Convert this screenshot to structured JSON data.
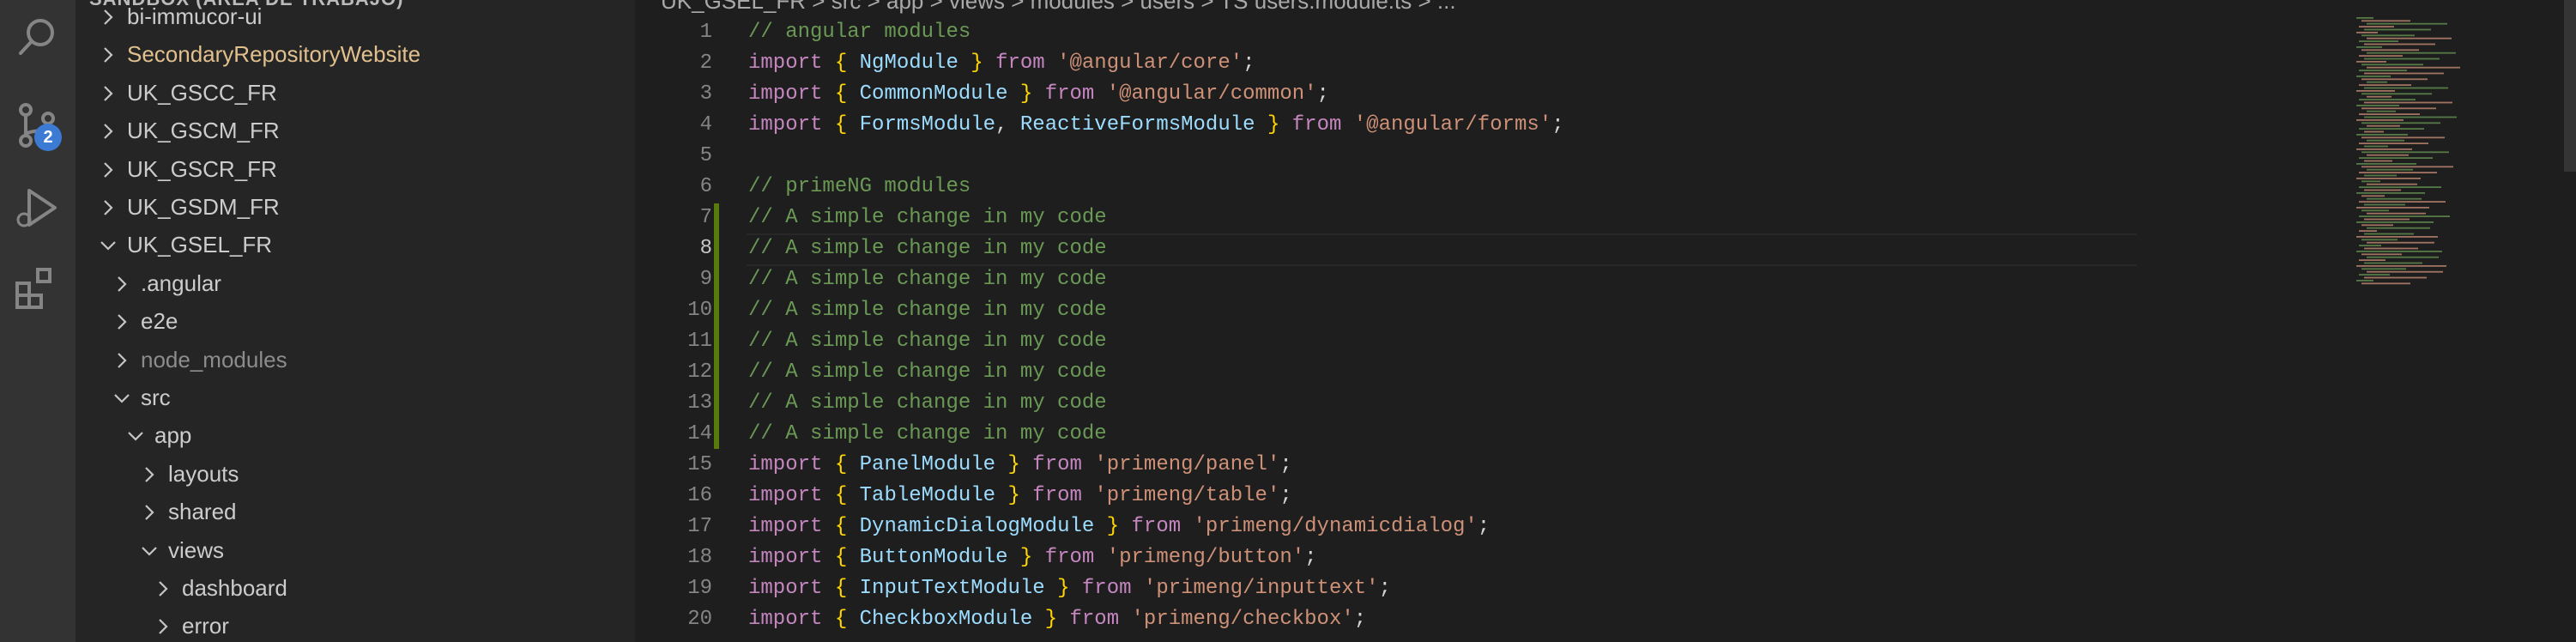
{
  "activity_bar": {
    "scm_badge": "2",
    "icons": [
      "search-icon",
      "source-control-icon",
      "run-debug-icon",
      "extensions-icon"
    ]
  },
  "sidebar": {
    "header": "SANDBOX (ÁREA DE TRABAJO)",
    "items": [
      {
        "label": "bi-immucor-ui",
        "indent": 0,
        "chevron": "right",
        "style": "normal"
      },
      {
        "label": "SecondaryRepositoryWebsite",
        "indent": 0,
        "chevron": "right",
        "style": "modified"
      },
      {
        "label": "UK_GSCC_FR",
        "indent": 0,
        "chevron": "right",
        "style": "normal"
      },
      {
        "label": "UK_GSCM_FR",
        "indent": 0,
        "chevron": "right",
        "style": "normal"
      },
      {
        "label": "UK_GSCR_FR",
        "indent": 0,
        "chevron": "right",
        "style": "normal"
      },
      {
        "label": "UK_GSDM_FR",
        "indent": 0,
        "chevron": "right",
        "style": "normal"
      },
      {
        "label": "UK_GSEL_FR",
        "indent": 0,
        "chevron": "down",
        "style": "normal"
      },
      {
        "label": ".angular",
        "indent": 1,
        "chevron": "right",
        "style": "normal"
      },
      {
        "label": "e2e",
        "indent": 1,
        "chevron": "right",
        "style": "normal"
      },
      {
        "label": "node_modules",
        "indent": 1,
        "chevron": "right",
        "style": "dim"
      },
      {
        "label": "src",
        "indent": 1,
        "chevron": "down",
        "style": "normal"
      },
      {
        "label": "app",
        "indent": 2,
        "chevron": "down",
        "style": "normal"
      },
      {
        "label": "layouts",
        "indent": 3,
        "chevron": "right",
        "style": "normal"
      },
      {
        "label": "shared",
        "indent": 3,
        "chevron": "right",
        "style": "normal"
      },
      {
        "label": "views",
        "indent": 3,
        "chevron": "down",
        "style": "normal"
      },
      {
        "label": "dashboard",
        "indent": 4,
        "chevron": "right",
        "style": "normal"
      },
      {
        "label": "error",
        "indent": 4,
        "chevron": "right",
        "style": "normal"
      }
    ]
  },
  "editor": {
    "breadcrumb": "UK_GSEL_FR > src > app > views > modules > users > TS users.module.ts > ...",
    "active_line": 8,
    "lines": [
      {
        "n": "1",
        "tokens": [
          [
            "c",
            "// angular modules"
          ]
        ]
      },
      {
        "n": "2",
        "tokens": [
          [
            "k",
            "import"
          ],
          [
            "p",
            " "
          ],
          [
            "b",
            "{"
          ],
          [
            "p",
            " "
          ],
          [
            "i",
            "NgModule"
          ],
          [
            "p",
            " "
          ],
          [
            "b",
            "}"
          ],
          [
            "p",
            " "
          ],
          [
            "k",
            "from"
          ],
          [
            "p",
            " "
          ],
          [
            "s",
            "'@angular/core'"
          ],
          [
            "p",
            ";"
          ]
        ]
      },
      {
        "n": "3",
        "tokens": [
          [
            "k",
            "import"
          ],
          [
            "p",
            " "
          ],
          [
            "b",
            "{"
          ],
          [
            "p",
            " "
          ],
          [
            "i",
            "CommonModule"
          ],
          [
            "p",
            " "
          ],
          [
            "b",
            "}"
          ],
          [
            "p",
            " "
          ],
          [
            "k",
            "from"
          ],
          [
            "p",
            " "
          ],
          [
            "s",
            "'@angular/common'"
          ],
          [
            "p",
            ";"
          ]
        ]
      },
      {
        "n": "4",
        "tokens": [
          [
            "k",
            "import"
          ],
          [
            "p",
            " "
          ],
          [
            "b",
            "{"
          ],
          [
            "p",
            " "
          ],
          [
            "i",
            "FormsModule"
          ],
          [
            "p",
            ", "
          ],
          [
            "i",
            "ReactiveFormsModule"
          ],
          [
            "p",
            " "
          ],
          [
            "b",
            "}"
          ],
          [
            "p",
            " "
          ],
          [
            "k",
            "from"
          ],
          [
            "p",
            " "
          ],
          [
            "s",
            "'@angular/forms'"
          ],
          [
            "p",
            ";"
          ]
        ]
      },
      {
        "n": "5",
        "tokens": []
      },
      {
        "n": "6",
        "tokens": [
          [
            "c",
            "// primeNG modules"
          ]
        ]
      },
      {
        "n": "7",
        "tokens": [
          [
            "c",
            "// A simple change in my code"
          ]
        ]
      },
      {
        "n": "8",
        "tokens": [
          [
            "c",
            "// A simple change in my code"
          ]
        ]
      },
      {
        "n": "9",
        "tokens": [
          [
            "c",
            "// A simple change in my code"
          ]
        ]
      },
      {
        "n": "10",
        "tokens": [
          [
            "c",
            "// A simple change in my code"
          ]
        ]
      },
      {
        "n": "11",
        "tokens": [
          [
            "c",
            "// A simple change in my code"
          ]
        ]
      },
      {
        "n": "12",
        "tokens": [
          [
            "c",
            "// A simple change in my code"
          ]
        ]
      },
      {
        "n": "13",
        "tokens": [
          [
            "c",
            "// A simple change in my code"
          ]
        ]
      },
      {
        "n": "14",
        "tokens": [
          [
            "c",
            "// A simple change in my code"
          ]
        ]
      },
      {
        "n": "15",
        "tokens": [
          [
            "k",
            "import"
          ],
          [
            "p",
            " "
          ],
          [
            "b",
            "{"
          ],
          [
            "p",
            " "
          ],
          [
            "i",
            "PanelModule"
          ],
          [
            "p",
            " "
          ],
          [
            "b",
            "}"
          ],
          [
            "p",
            " "
          ],
          [
            "k",
            "from"
          ],
          [
            "p",
            " "
          ],
          [
            "s",
            "'primeng/panel'"
          ],
          [
            "p",
            ";"
          ]
        ]
      },
      {
        "n": "16",
        "tokens": [
          [
            "k",
            "import"
          ],
          [
            "p",
            " "
          ],
          [
            "b",
            "{"
          ],
          [
            "p",
            " "
          ],
          [
            "i",
            "TableModule"
          ],
          [
            "p",
            " "
          ],
          [
            "b",
            "}"
          ],
          [
            "p",
            " "
          ],
          [
            "k",
            "from"
          ],
          [
            "p",
            " "
          ],
          [
            "s",
            "'primeng/table'"
          ],
          [
            "p",
            ";"
          ]
        ]
      },
      {
        "n": "17",
        "tokens": [
          [
            "k",
            "import"
          ],
          [
            "p",
            " "
          ],
          [
            "b",
            "{"
          ],
          [
            "p",
            " "
          ],
          [
            "i",
            "DynamicDialogModule"
          ],
          [
            "p",
            " "
          ],
          [
            "b",
            "}"
          ],
          [
            "p",
            " "
          ],
          [
            "k",
            "from"
          ],
          [
            "p",
            " "
          ],
          [
            "s",
            "'primeng/dynamicdialog'"
          ],
          [
            "p",
            ";"
          ]
        ]
      },
      {
        "n": "18",
        "tokens": [
          [
            "k",
            "import"
          ],
          [
            "p",
            " "
          ],
          [
            "b",
            "{"
          ],
          [
            "p",
            " "
          ],
          [
            "i",
            "ButtonModule"
          ],
          [
            "p",
            " "
          ],
          [
            "b",
            "}"
          ],
          [
            "p",
            " "
          ],
          [
            "k",
            "from"
          ],
          [
            "p",
            " "
          ],
          [
            "s",
            "'primeng/button'"
          ],
          [
            "p",
            ";"
          ]
        ]
      },
      {
        "n": "19",
        "tokens": [
          [
            "k",
            "import"
          ],
          [
            "p",
            " "
          ],
          [
            "b",
            "{"
          ],
          [
            "p",
            " "
          ],
          [
            "i",
            "InputTextModule"
          ],
          [
            "p",
            " "
          ],
          [
            "b",
            "}"
          ],
          [
            "p",
            " "
          ],
          [
            "k",
            "from"
          ],
          [
            "p",
            " "
          ],
          [
            "s",
            "'primeng/inputtext'"
          ],
          [
            "p",
            ";"
          ]
        ]
      },
      {
        "n": "20",
        "tokens": [
          [
            "k",
            "import"
          ],
          [
            "p",
            " "
          ],
          [
            "b",
            "{"
          ],
          [
            "p",
            " "
          ],
          [
            "i",
            "CheckboxModule"
          ],
          [
            "p",
            " "
          ],
          [
            "b",
            "}"
          ],
          [
            "p",
            " "
          ],
          [
            "k",
            "from"
          ],
          [
            "p",
            " "
          ],
          [
            "s",
            "'primeng/checkbox'"
          ],
          [
            "p",
            ";"
          ]
        ]
      }
    ]
  }
}
